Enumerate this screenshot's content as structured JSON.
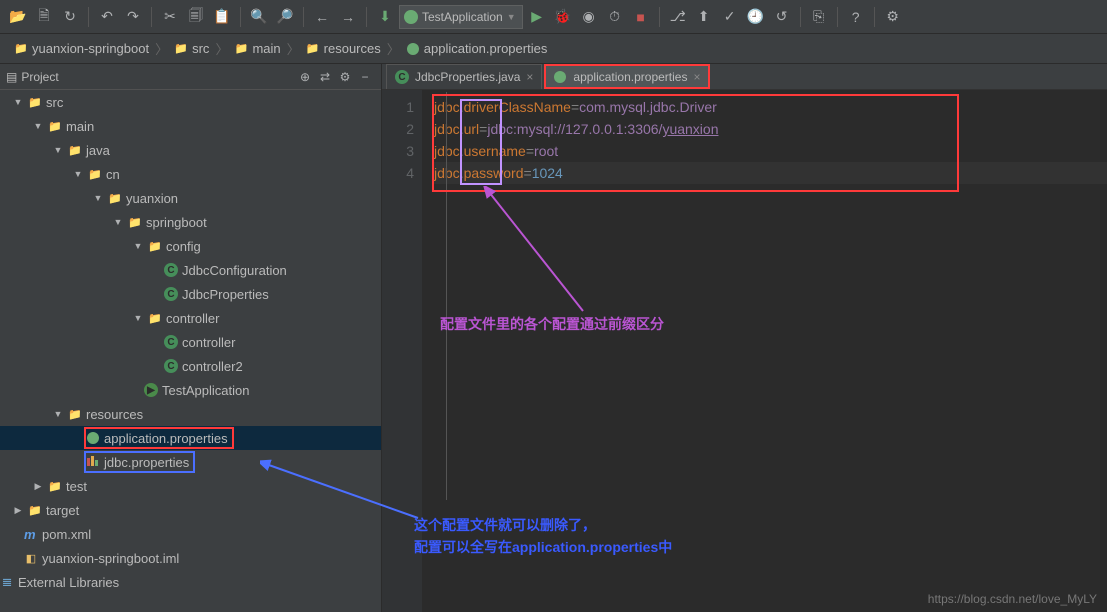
{
  "toolbar": {
    "run_config": "TestApplication"
  },
  "breadcrumbs": {
    "items": [
      "yuanxion-springboot",
      "src",
      "main",
      "resources",
      "application.properties"
    ]
  },
  "project": {
    "title": "Project"
  },
  "tree": {
    "src": "src",
    "main": "main",
    "java": "java",
    "cn": "cn",
    "yuanxion": "yuanxion",
    "springboot": "springboot",
    "config": "config",
    "jdbcConfiguration": "JdbcConfiguration",
    "jdbcProperties": "JdbcProperties",
    "controller": "controller",
    "controller_c": "controller",
    "controller2": "controller2",
    "testApp": "TestApplication",
    "resources": "resources",
    "appProps": "application.properties",
    "jdbcProps": "jdbc.properties",
    "test": "test",
    "target": "target",
    "pom": "pom.xml",
    "iml": "yuanxion-springboot.iml",
    "extLib": "External Libraries"
  },
  "tabs": {
    "t1": "JdbcProperties.java",
    "t2": "application.properties"
  },
  "code": {
    "lines": [
      "1",
      "2",
      "3",
      "4"
    ],
    "l1_key": "jdbc",
    "l1_dot": ".",
    "l1_prop": "driverClassName",
    "l1_eq": "=",
    "l1_val": "com.mysql.jdbc.Driver",
    "l2_key": "jdbc",
    "l2_dot": ".",
    "l2_prop": "url",
    "l2_eq": "=",
    "l2_proto": "jdbc:mysql:",
    "l2_path": "//127.0.0.1:3306/",
    "l2_db": "yuanxion",
    "l3_key": "jdbc",
    "l3_dot": ".",
    "l3_prop": "username",
    "l3_eq": "=",
    "l3_val": "root",
    "l4_key": "jdbc",
    "l4_dot": ".",
    "l4_prop": "password",
    "l4_eq": "=",
    "l4_val": "1024"
  },
  "annot": {
    "purple": "配置文件里的各个配置通过前缀区分",
    "blue_l1": "这个配置文件就可以删除了，",
    "blue_l2": "配置可以全写在application.properties中"
  },
  "watermark": "https://blog.csdn.net/love_MyLY"
}
